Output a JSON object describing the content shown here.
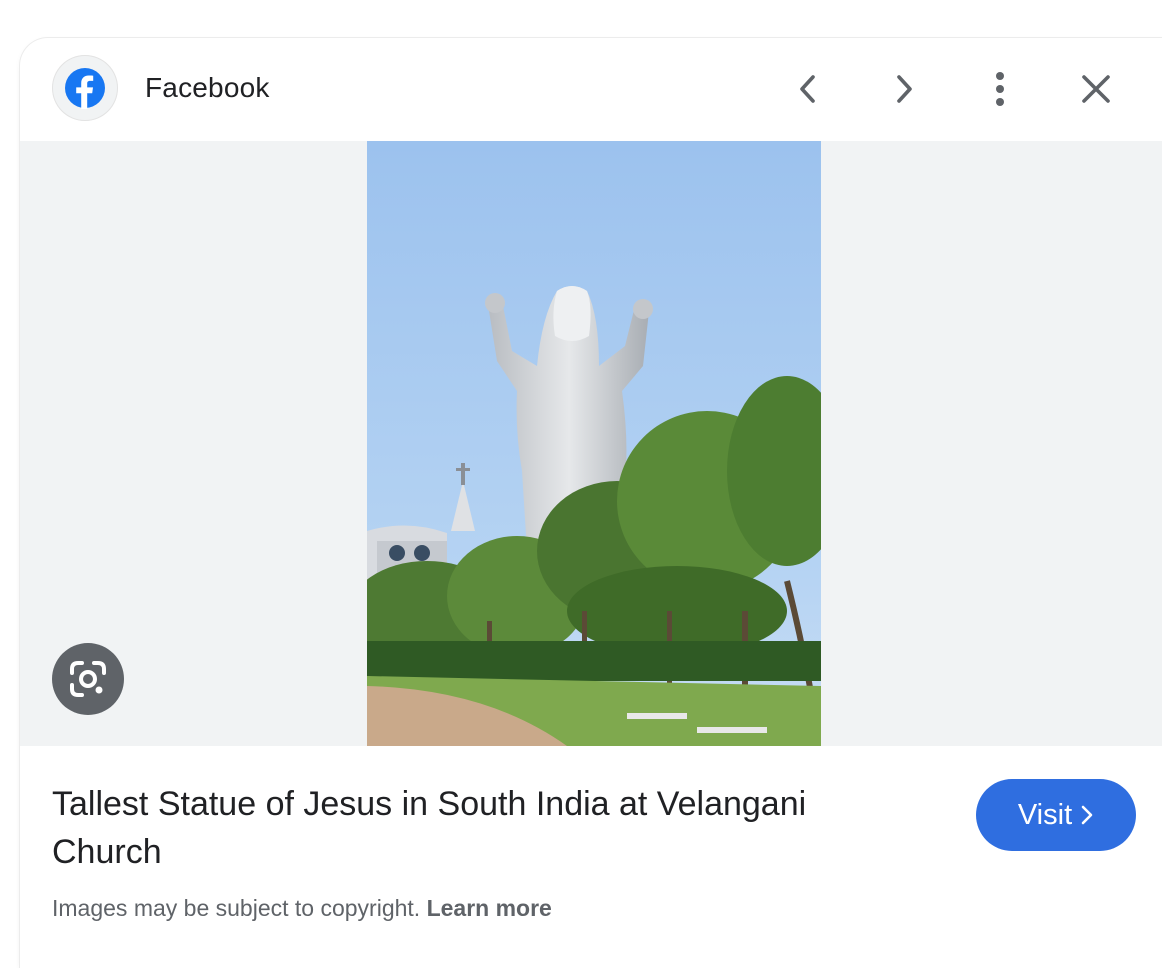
{
  "header": {
    "source_name": "Facebook",
    "icons": {
      "logo": "facebook-icon",
      "prev": "chevron-left-icon",
      "next": "chevron-right-icon",
      "more": "more-vert-icon",
      "close": "close-icon"
    }
  },
  "image": {
    "lens_icon": "google-lens-icon"
  },
  "result": {
    "title": "Tallest Statue of Jesus in South India at Velangani Church",
    "visit_label": "Visit",
    "visit_icon": "chevron-right-icon",
    "copyright_text": "Images may be subject to copyright.",
    "learn_more_label": "Learn more"
  },
  "colors": {
    "accent": "#2f6ee0",
    "facebook_blue": "#1877f2",
    "stage_bg": "#f1f3f4",
    "icon_gray": "#5f6368"
  }
}
